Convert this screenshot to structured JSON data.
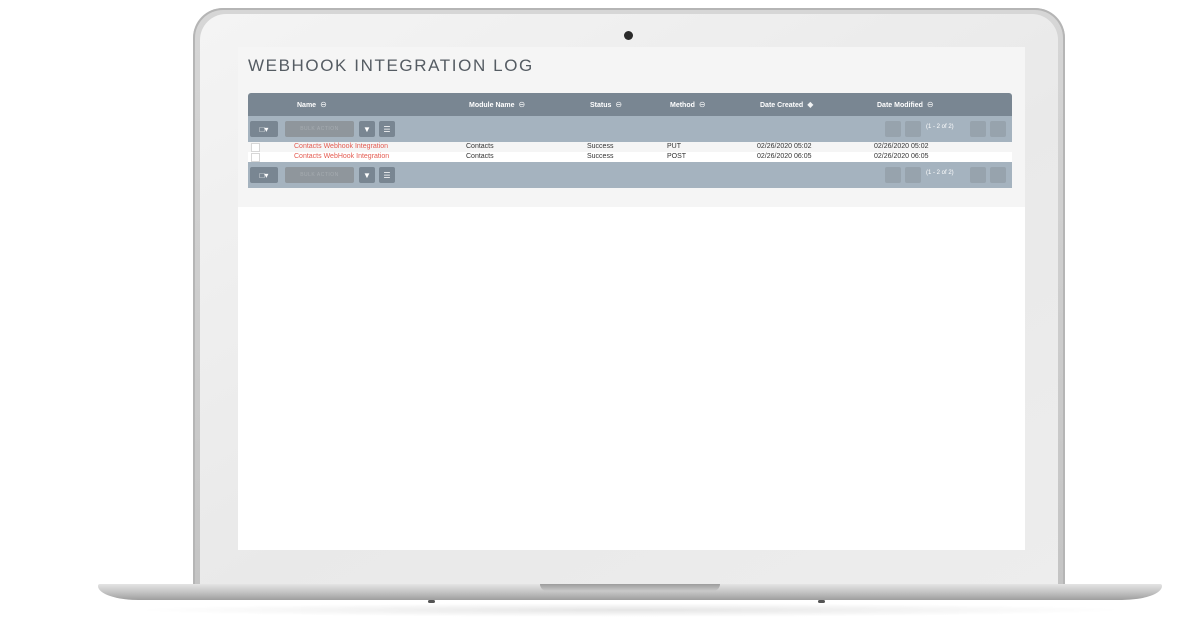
{
  "page": {
    "title": "WEBHOOK INTEGRATION LOG"
  },
  "columns": [
    {
      "label": "Name",
      "sort": "⊖"
    },
    {
      "label": "Module Name",
      "sort": "⊖"
    },
    {
      "label": "Status",
      "sort": "⊖"
    },
    {
      "label": "Method",
      "sort": "⊖"
    },
    {
      "label": "Date Created",
      "sort": "◆"
    },
    {
      "label": "Date Modified",
      "sort": "⊖"
    }
  ],
  "toolbar": {
    "select_icon": "checkbox-dropdown-icon",
    "bulk_action_label": "BULK ACTION",
    "filter_icon": "filter-icon",
    "columns_icon": "list-icon",
    "pagination_text": "(1 - 2 of 2)"
  },
  "rows": [
    {
      "name": "Contacts Webhook Integration",
      "module": "Contacts",
      "status": "Success",
      "method": "PUT",
      "created": "02/26/2020 05:02",
      "modified": "02/26/2020 05:02"
    },
    {
      "name": "Contacts WebHook Integration",
      "module": "Contacts",
      "status": "Success",
      "method": "POST",
      "created": "02/26/2020 06:05",
      "modified": "02/26/2020 06:05"
    }
  ],
  "colors": {
    "header": "#798692",
    "action_bar": "#a5b3bf",
    "link": "#e45c52",
    "title": "#555c63"
  }
}
